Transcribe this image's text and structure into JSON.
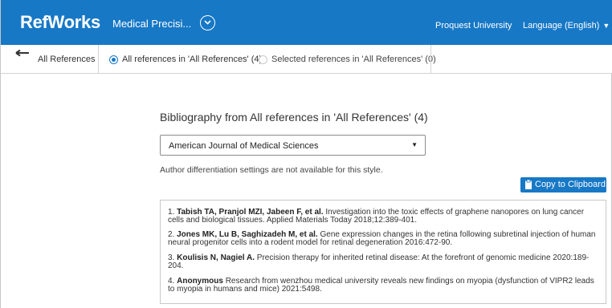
{
  "header": {
    "logo": "RefWorks",
    "project_name": "Medical Precisi...",
    "institution": "Proquest University",
    "language": "Language (English)"
  },
  "toolbar": {
    "breadcrumb": "All References",
    "option_all": "All references in 'All References' (4)",
    "option_selected": "Selected references in 'All References' (0)",
    "selected_option": "all"
  },
  "bibliography": {
    "title": "Bibliography from All references in 'All References' (4)",
    "style": "American Journal of Medical Sciences",
    "note": "Author differentiation settings are not available for this style.",
    "copy_button": "Copy to Clipboard",
    "entries": [
      {
        "number": "1.",
        "authors": "Tabish TA, Pranjol MZI, Jabeen F, et al.",
        "line1": "Investigation into the toxic effects of graphene nanopores on lung cancer",
        "line2": "cells and biological tissues. Applied Materials Today 2018;12:389-401."
      },
      {
        "number": "2.",
        "authors": "Jones MK, Lu B, Saghizadeh M, et al.",
        "line1": "Gene expression changes in the retina following subretinal injection of human",
        "line2": "neural progenitor cells into a rodent model for retinal degeneration 2016:472-90."
      },
      {
        "number": "3.",
        "authors": "Koulisis N, Nagiel A.",
        "line1": "Precision therapy for inherited retinal disease: At the forefront of genomic medicine 2020:189-",
        "line2": "204."
      },
      {
        "number": "4.",
        "authors": "Anonymous",
        "line1": "Research from wenzhou medical university reveals new findings on myopia (dysfunction of VIPR2 leads",
        "line2": "to myopia in humans and mice) 2021:5498."
      }
    ]
  },
  "colors": {
    "brand_blue": "#1778c6"
  }
}
